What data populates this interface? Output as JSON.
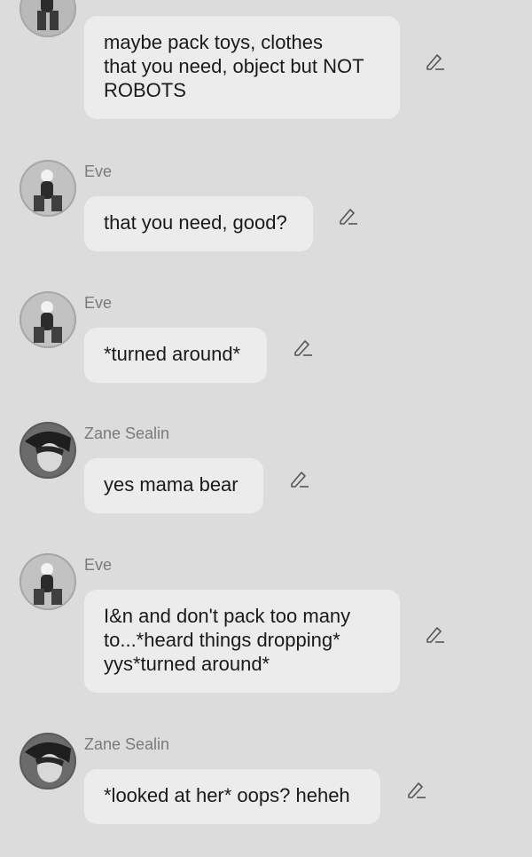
{
  "messages": [
    {
      "sender": "",
      "avatar": "eve-avatar",
      "text": "maybe pack toys, clothes\nthat you need, object but NOT\nROBOTS"
    },
    {
      "sender": "Eve",
      "avatar": "eve-avatar",
      "text": "that you need, good?"
    },
    {
      "sender": "Eve",
      "avatar": "eve-avatar",
      "text": "*turned around*"
    },
    {
      "sender": "Zane Sealin",
      "avatar": "zane-avatar",
      "text": "yes mama bear"
    },
    {
      "sender": "Eve",
      "avatar": "eve-avatar",
      "text": "I&n and don't pack too many\nto...*heard things dropping*\nyys*turned around*"
    },
    {
      "sender": "Zane Sealin",
      "avatar": "zane-avatar",
      "text": "*looked at her* oops? heheh"
    }
  ],
  "icons": {
    "edit": "pencil-icon"
  },
  "colors": {
    "background": "#dcdcdc",
    "bubble": "#ececec",
    "sender_text": "#7a7a7a",
    "message_text": "#1a1a1a"
  }
}
